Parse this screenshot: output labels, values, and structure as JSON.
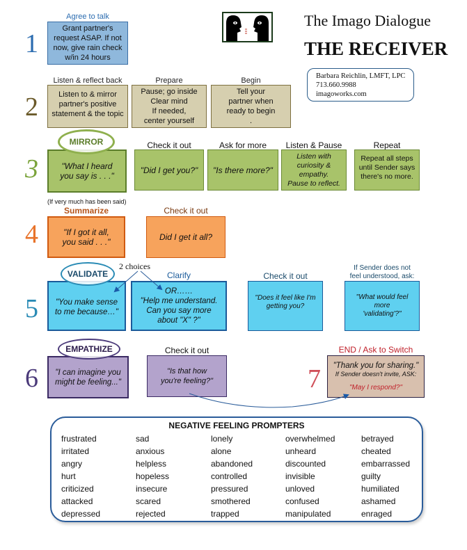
{
  "header": {
    "title": "The Imago Dialogue",
    "subtitle": "THE RECEIVER",
    "contact": {
      "name": "Barbara Reichlin, LMFT, LPC",
      "phone": "713.660.9988",
      "website": "imagoworks.com"
    },
    "logo_icon": "two-faces-talking-icon"
  },
  "steps": {
    "s1": {
      "number": "1",
      "label": "Agree to talk",
      "text": [
        "Grant partner's",
        "request  ASAP. If not",
        "now, give rain check",
        "w/in 24 hours"
      ]
    },
    "s2": {
      "number": "2",
      "boxes": [
        {
          "label": "Listen & reflect back",
          "text": [
            "Listen to & mirror",
            "partner's positive",
            "statement & the topic"
          ]
        },
        {
          "label": "Prepare",
          "text": [
            "Pause; go inside",
            "Clear mind",
            "If needed,",
            "center yourself"
          ]
        },
        {
          "label": "Begin",
          "text": [
            "Tell your",
            "partner when",
            "ready to begin",
            "."
          ]
        }
      ]
    },
    "s3": {
      "number": "3",
      "oval": "MIRROR",
      "boxes": [
        {
          "label": "",
          "text": [
            "\"What I heard",
            "you say is . . .\""
          ]
        },
        {
          "label": "Check it out",
          "text": [
            "\"Did I get you?\""
          ]
        },
        {
          "label": "Ask for more",
          "text": [
            "\"Is there more?\""
          ]
        },
        {
          "label": "Listen & Pause",
          "text": [
            "Listen with",
            "curiosity &",
            "empathy.",
            "Pause to reflect."
          ]
        },
        {
          "label": "Repeat",
          "text": [
            "Repeat all steps",
            "until Sender says",
            "there's no more."
          ]
        }
      ]
    },
    "s4": {
      "number": "4",
      "note": "(If very much has been said)",
      "boxes": [
        {
          "label": "Summarize",
          "text": [
            "\"If I got it all,",
            "you said . . .\""
          ]
        },
        {
          "label": "Check it out",
          "text": [
            "Did I get it all?"
          ]
        }
      ]
    },
    "s5": {
      "number": "5",
      "oval": "VALIDATE",
      "choices_note": "2 choices",
      "boxes": [
        {
          "label": "",
          "text": [
            "\"You make sense",
            "to me because…\""
          ]
        },
        {
          "label": "Clarify",
          "text": [
            "OR……",
            "\"Help me understand.",
            "Can you say more",
            "about \"X\" ?\""
          ]
        },
        {
          "label": "Check it out",
          "text": [
            "\"Does it feel like I'm",
            "getting you?"
          ]
        },
        {
          "label": "If Sender does not\nfeel understood, ask:",
          "text": [
            "\"What would feel",
            "more",
            "'validating'?\""
          ]
        }
      ]
    },
    "s6": {
      "number": "6",
      "oval": "EMPATHIZE",
      "boxes": [
        {
          "label": "",
          "text": [
            "\"I can imagine you",
            "might be feeling...\""
          ]
        },
        {
          "label": "Check it out",
          "text": [
            "\"Is that how",
            "you're feeling?\""
          ]
        }
      ]
    },
    "s7": {
      "number": "7",
      "label": "END / Ask to Switch",
      "line1": "\"Thank you for sharing.\"",
      "line2": "If Sender doesn't invite, ASK:",
      "line3": "\"May I respond?\""
    }
  },
  "feelings": {
    "title": "NEGATIVE FEELING PROMPTERS",
    "columns": [
      [
        "frustrated",
        "irritated",
        "angry",
        "hurt",
        "criticized",
        "attacked",
        "depressed"
      ],
      [
        "sad",
        "anxious",
        "helpless",
        "hopeless",
        "insecure",
        "scared",
        "rejected"
      ],
      [
        "lonely",
        "alone",
        "abandoned",
        "controlled",
        "pressured",
        "smothered",
        "trapped"
      ],
      [
        "overwhelmed",
        "unheard",
        "discounted",
        "invisible",
        "unloved",
        "confused",
        "manipulated"
      ],
      [
        "betrayed",
        "cheated",
        "embarrassed",
        "guilty",
        "humiliated",
        "ashamed",
        "enraged"
      ]
    ]
  },
  "colors": {
    "step1": "#2b6cb0",
    "step2": "#6b5a2a",
    "step3": "#7aa33a",
    "step4": "#e8732a",
    "step5": "#2a8bb5",
    "step6": "#4b3a7a",
    "step7": "#d0505a"
  }
}
